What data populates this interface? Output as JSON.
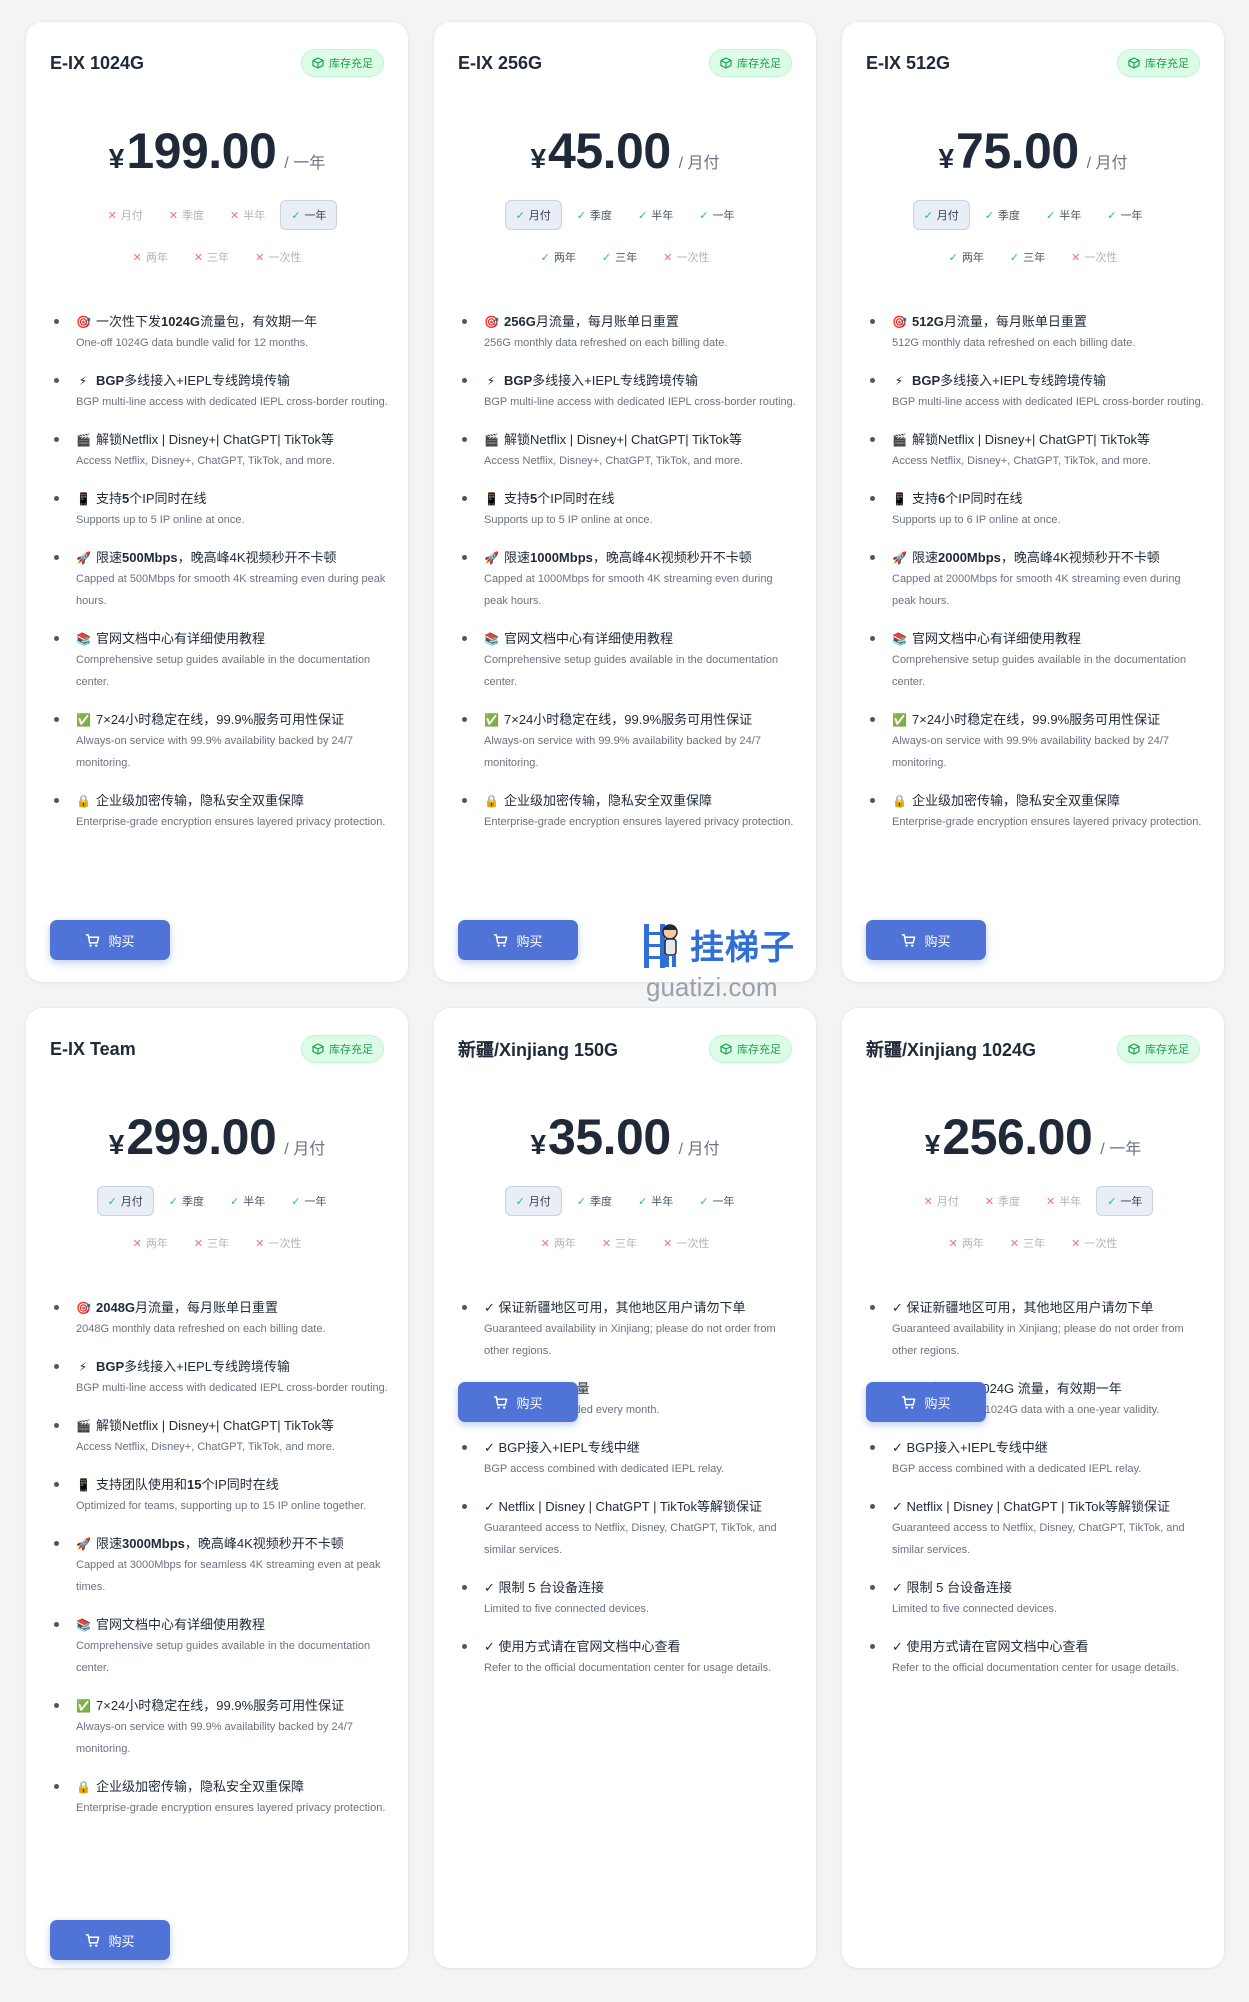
{
  "labels": {
    "buy": "购买",
    "stock": "库存充足"
  },
  "colors": {
    "accent": "#4f73d6",
    "stock_bg": "#dcfce7",
    "stock_text": "#16a34a"
  },
  "plans": [
    {
      "name": "E-IX 1024G",
      "currency": "¥",
      "price": "199.00",
      "period": "/ 一年",
      "cycles": [
        {
          "label": "月付",
          "state": "no"
        },
        {
          "label": "季度",
          "state": "no"
        },
        {
          "label": "半年",
          "state": "no"
        },
        {
          "label": "一年",
          "state": "active"
        },
        {
          "label": "两年",
          "state": "no"
        },
        {
          "label": "三年",
          "state": "no"
        },
        {
          "label": "一次性",
          "state": "no"
        }
      ],
      "features": [
        {
          "icon": "🎯",
          "pre": "一次性下发",
          "bold": "1024G",
          "post": "流量包，有效期一年",
          "desc": "One-off 1024G data bundle valid for 12 months."
        },
        {
          "icon": "⚡",
          "pre": "",
          "bold": "BGP",
          "post": "多线接入+IEPL专线跨境传输",
          "desc": "BGP multi-line access with dedicated IEPL cross-border routing."
        },
        {
          "icon": "🎬",
          "pre": "",
          "bold": "",
          "post": "解锁Netflix | Disney+| ChatGPT| TikTok等",
          "desc": "Access Netflix, Disney+, ChatGPT, TikTok, and more."
        },
        {
          "icon": "📱",
          "pre": "支持",
          "bold": "5",
          "post": "个IP同时在线",
          "desc": "Supports up to 5 IP online at once."
        },
        {
          "icon": "🚀",
          "pre": "限速",
          "bold": "500Mbps",
          "post": "，晚高峰4K视频秒开不卡顿",
          "desc": "Capped at 500Mbps for smooth 4K streaming even during peak hours."
        },
        {
          "icon": "📚",
          "pre": "",
          "bold": "",
          "post": "官网文档中心有详细使用教程",
          "desc": "Comprehensive setup guides available in the documentation center."
        },
        {
          "icon": "✅",
          "pre": "",
          "bold": "",
          "post": "7×24小时稳定在线，99.9%服务可用性保证",
          "desc": "Always-on service with 99.9% availability backed by 24/7 monitoring."
        },
        {
          "icon": "🔒",
          "pre": "",
          "bold": "",
          "post": "企业级加密传输，隐私安全双重保障",
          "desc": "Enterprise-grade encryption ensures layered privacy protection."
        }
      ]
    },
    {
      "name": "E-IX 256G",
      "currency": "¥",
      "price": "45.00",
      "period": "/ 月付",
      "cycles": [
        {
          "label": "月付",
          "state": "active"
        },
        {
          "label": "季度",
          "state": "yes"
        },
        {
          "label": "半年",
          "state": "yes"
        },
        {
          "label": "一年",
          "state": "yes"
        },
        {
          "label": "两年",
          "state": "yes"
        },
        {
          "label": "三年",
          "state": "yes"
        },
        {
          "label": "一次性",
          "state": "no"
        }
      ],
      "features": [
        {
          "icon": "🎯",
          "pre": "",
          "bold": "256G",
          "post": "月流量，每月账单日重置",
          "desc": "256G monthly data refreshed on each billing date."
        },
        {
          "icon": "⚡",
          "pre": "",
          "bold": "BGP",
          "post": "多线接入+IEPL专线跨境传输",
          "desc": "BGP multi-line access with dedicated IEPL cross-border routing."
        },
        {
          "icon": "🎬",
          "pre": "",
          "bold": "",
          "post": "解锁Netflix | Disney+| ChatGPT| TikTok等",
          "desc": "Access Netflix, Disney+, ChatGPT, TikTok, and more."
        },
        {
          "icon": "📱",
          "pre": "支持",
          "bold": "5",
          "post": "个IP同时在线",
          "desc": "Supports up to 5 IP online at once."
        },
        {
          "icon": "🚀",
          "pre": "限速",
          "bold": "1000Mbps",
          "post": "，晚高峰4K视频秒开不卡顿",
          "desc": "Capped at 1000Mbps for smooth 4K streaming even during peak hours."
        },
        {
          "icon": "📚",
          "pre": "",
          "bold": "",
          "post": "官网文档中心有详细使用教程",
          "desc": "Comprehensive setup guides available in the documentation center."
        },
        {
          "icon": "✅",
          "pre": "",
          "bold": "",
          "post": "7×24小时稳定在线，99.9%服务可用性保证",
          "desc": "Always-on service with 99.9% availability backed by 24/7 monitoring."
        },
        {
          "icon": "🔒",
          "pre": "",
          "bold": "",
          "post": "企业级加密传输，隐私安全双重保障",
          "desc": "Enterprise-grade encryption ensures layered privacy protection."
        }
      ]
    },
    {
      "name": "E-IX 512G",
      "currency": "¥",
      "price": "75.00",
      "period": "/ 月付",
      "cycles": [
        {
          "label": "月付",
          "state": "active"
        },
        {
          "label": "季度",
          "state": "yes"
        },
        {
          "label": "半年",
          "state": "yes"
        },
        {
          "label": "一年",
          "state": "yes"
        },
        {
          "label": "两年",
          "state": "yes"
        },
        {
          "label": "三年",
          "state": "yes"
        },
        {
          "label": "一次性",
          "state": "no"
        }
      ],
      "features": [
        {
          "icon": "🎯",
          "pre": "",
          "bold": "512G",
          "post": "月流量，每月账单日重置",
          "desc": "512G monthly data refreshed on each billing date."
        },
        {
          "icon": "⚡",
          "pre": "",
          "bold": "BGP",
          "post": "多线接入+IEPL专线跨境传输",
          "desc": "BGP multi-line access with dedicated IEPL cross-border routing."
        },
        {
          "icon": "🎬",
          "pre": "",
          "bold": "",
          "post": "解锁Netflix | Disney+| ChatGPT| TikTok等",
          "desc": "Access Netflix, Disney+, ChatGPT, TikTok, and more."
        },
        {
          "icon": "📱",
          "pre": "支持",
          "bold": "6",
          "post": "个IP同时在线",
          "desc": "Supports up to 6 IP online at once."
        },
        {
          "icon": "🚀",
          "pre": "限速",
          "bold": "2000Mbps",
          "post": "，晚高峰4K视频秒开不卡顿",
          "desc": "Capped at 2000Mbps for smooth 4K streaming even during peak hours."
        },
        {
          "icon": "📚",
          "pre": "",
          "bold": "",
          "post": "官网文档中心有详细使用教程",
          "desc": "Comprehensive setup guides available in the documentation center."
        },
        {
          "icon": "✅",
          "pre": "",
          "bold": "",
          "post": "7×24小时稳定在线，99.9%服务可用性保证",
          "desc": "Always-on service with 99.9% availability backed by 24/7 monitoring."
        },
        {
          "icon": "🔒",
          "pre": "",
          "bold": "",
          "post": "企业级加密传输，隐私安全双重保障",
          "desc": "Enterprise-grade encryption ensures layered privacy protection."
        }
      ]
    },
    {
      "name": "E-IX Team",
      "currency": "¥",
      "price": "299.00",
      "period": "/ 月付",
      "cycles": [
        {
          "label": "月付",
          "state": "active"
        },
        {
          "label": "季度",
          "state": "yes"
        },
        {
          "label": "半年",
          "state": "yes"
        },
        {
          "label": "一年",
          "state": "yes"
        },
        {
          "label": "两年",
          "state": "no"
        },
        {
          "label": "三年",
          "state": "no"
        },
        {
          "label": "一次性",
          "state": "no"
        }
      ],
      "features": [
        {
          "icon": "🎯",
          "pre": "",
          "bold": "2048G",
          "post": "月流量，每月账单日重置",
          "desc": "2048G monthly data refreshed on each billing date."
        },
        {
          "icon": "⚡",
          "pre": "",
          "bold": "BGP",
          "post": "多线接入+IEPL专线跨境传输",
          "desc": "BGP multi-line access with dedicated IEPL cross-border routing."
        },
        {
          "icon": "🎬",
          "pre": "",
          "bold": "",
          "post": "解锁Netflix | Disney+| ChatGPT| TikTok等",
          "desc": "Access Netflix, Disney+, ChatGPT, TikTok, and more."
        },
        {
          "icon": "📱",
          "pre": "支持团队使用和",
          "bold": "15",
          "post": "个IP同时在线",
          "desc": "Optimized for teams, supporting up to 15 IP online together."
        },
        {
          "icon": "🚀",
          "pre": "限速",
          "bold": "3000Mbps",
          "post": "，晚高峰4K视频秒开不卡顿",
          "desc": "Capped at 3000Mbps for seamless 4K streaming even at peak times."
        },
        {
          "icon": "📚",
          "pre": "",
          "bold": "",
          "post": "官网文档中心有详细使用教程",
          "desc": "Comprehensive setup guides available in the documentation center."
        },
        {
          "icon": "✅",
          "pre": "",
          "bold": "",
          "post": "7×24小时稳定在线，99.9%服务可用性保证",
          "desc": "Always-on service with 99.9% availability backed by 24/7 monitoring."
        },
        {
          "icon": "🔒",
          "pre": "",
          "bold": "",
          "post": "企业级加密传输，隐私安全双重保障",
          "desc": "Enterprise-grade encryption ensures layered privacy protection."
        }
      ]
    },
    {
      "name": "新疆/Xinjiang 150G",
      "currency": "¥",
      "price": "35.00",
      "period": "/ 月付",
      "cycles": [
        {
          "label": "月付",
          "state": "active"
        },
        {
          "label": "季度",
          "state": "yes"
        },
        {
          "label": "半年",
          "state": "yes"
        },
        {
          "label": "一年",
          "state": "yes"
        },
        {
          "label": "两年",
          "state": "no"
        },
        {
          "label": "三年",
          "state": "no"
        },
        {
          "label": "一次性",
          "state": "no"
        }
      ],
      "features": [
        {
          "icon": "",
          "pre": "",
          "bold": "",
          "post": "✓ 保证新疆地区可用，其他地区用户请勿下单",
          "desc": "Guaranteed availability in Xinjiang; please do not order from other regions."
        },
        {
          "icon": "",
          "pre": "",
          "bold": "",
          "post": "✓ 每月 150G 流量",
          "desc": "150G of data provided every month."
        },
        {
          "icon": "",
          "pre": "",
          "bold": "",
          "post": "✓ BGP接入+IEPL专线中继",
          "desc": "BGP access combined with dedicated IEPL relay."
        },
        {
          "icon": "",
          "pre": "",
          "bold": "",
          "post": "✓ Netflix | Disney | ChatGPT | TikTok等解锁保证",
          "desc": "Guaranteed access to Netflix, Disney, ChatGPT, TikTok, and similar services."
        },
        {
          "icon": "",
          "pre": "",
          "bold": "",
          "post": "✓ 限制 5 台设备连接",
          "desc": "Limited to five connected devices."
        },
        {
          "icon": "",
          "pre": "",
          "bold": "",
          "post": "✓ 使用方式请在官网文档中心查看",
          "desc": "Refer to the official documentation center for usage details."
        }
      ]
    },
    {
      "name": "新疆/Xinjiang 1024G",
      "currency": "¥",
      "price": "256.00",
      "period": "/ 一年",
      "cycles": [
        {
          "label": "月付",
          "state": "no"
        },
        {
          "label": "季度",
          "state": "no"
        },
        {
          "label": "半年",
          "state": "no"
        },
        {
          "label": "一年",
          "state": "active"
        },
        {
          "label": "两年",
          "state": "no"
        },
        {
          "label": "三年",
          "state": "no"
        },
        {
          "label": "一次性",
          "state": "no"
        }
      ],
      "features": [
        {
          "icon": "",
          "pre": "",
          "bold": "",
          "post": "✓ 保证新疆地区可用，其他地区用户请勿下单",
          "desc": "Guaranteed availability in Xinjiang; please do not order from other regions."
        },
        {
          "icon": "",
          "pre": "",
          "bold": "",
          "post": "✓ 一次性下发 1024G 流量，有效期一年",
          "desc": "One-off delivery of 1024G data with a one-year validity."
        },
        {
          "icon": "",
          "pre": "",
          "bold": "",
          "post": "✓ BGP接入+IEPL专线中继",
          "desc": "BGP access combined with a dedicated IEPL relay."
        },
        {
          "icon": "",
          "pre": "",
          "bold": "",
          "post": "✓ Netflix | Disney | ChatGPT | TikTok等解锁保证",
          "desc": "Guaranteed access to Netflix, Disney, ChatGPT, TikTok, and similar services."
        },
        {
          "icon": "",
          "pre": "",
          "bold": "",
          "post": "✓ 限制 5 台设备连接",
          "desc": "Limited to five connected devices."
        },
        {
          "icon": "",
          "pre": "",
          "bold": "",
          "post": "✓ 使用方式请在官网文档中心查看",
          "desc": "Refer to the official documentation center for usage details."
        }
      ]
    }
  ],
  "watermark": {
    "cn": "挂梯子",
    "en": "guatizi.com"
  }
}
